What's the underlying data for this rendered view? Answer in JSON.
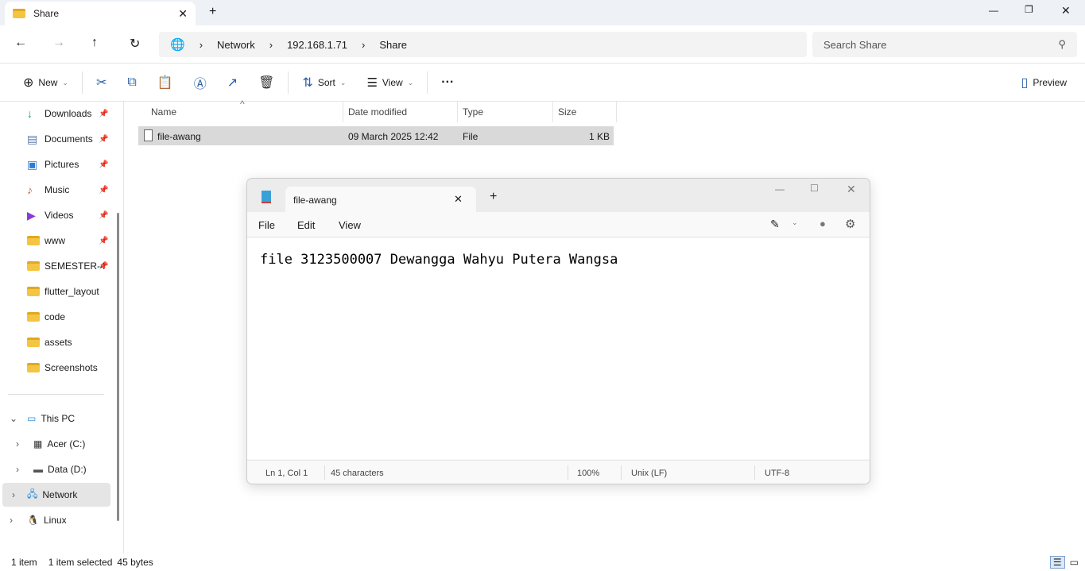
{
  "window": {
    "tab_title": "Share"
  },
  "address": {
    "segments": [
      "Network",
      "192.168.1.71",
      "Share"
    ],
    "search_placeholder": "Search Share"
  },
  "toolbar": {
    "new": "New",
    "sort": "Sort",
    "view": "View",
    "preview": "Preview"
  },
  "sidebar": {
    "quick": [
      {
        "label": "Downloads",
        "icon": "download-icon",
        "pinned": true
      },
      {
        "label": "Documents",
        "icon": "documents-icon",
        "pinned": true
      },
      {
        "label": "Pictures",
        "icon": "pictures-icon",
        "pinned": true
      },
      {
        "label": "Music",
        "icon": "music-icon",
        "pinned": true
      },
      {
        "label": "Videos",
        "icon": "videos-icon",
        "pinned": true
      },
      {
        "label": "www",
        "icon": "folder-icon",
        "pinned": true
      },
      {
        "label": "SEMESTER-4",
        "icon": "folder-icon",
        "pinned": true
      },
      {
        "label": "flutter_layout",
        "icon": "folder-icon"
      },
      {
        "label": "code",
        "icon": "folder-icon"
      },
      {
        "label": "assets",
        "icon": "folder-icon"
      },
      {
        "label": "Screenshots",
        "icon": "folder-icon"
      }
    ],
    "tree": [
      {
        "label": "This PC"
      },
      {
        "label": "Acer (C:)"
      },
      {
        "label": "Data (D:)"
      },
      {
        "label": "Network"
      },
      {
        "label": "Linux"
      }
    ]
  },
  "files": {
    "columns": [
      "Name",
      "Date modified",
      "Type",
      "Size"
    ],
    "rows": [
      {
        "name": "file-awang",
        "date": "09 March 2025 12:42",
        "type": "File",
        "size": "1 KB"
      }
    ]
  },
  "notepad": {
    "tab_title": "file-awang",
    "menu": [
      "File",
      "Edit",
      "View"
    ],
    "content": "file 3123500007 Dewangga Wahyu Putera Wangsa",
    "status": {
      "pos": "Ln 1, Col 1",
      "chars": "45 characters",
      "zoom": "100%",
      "eol": "Unix (LF)",
      "encoding": "UTF-8"
    }
  },
  "statusbar": {
    "count": "1 item",
    "selected": "1 item selected",
    "size": "45 bytes"
  }
}
